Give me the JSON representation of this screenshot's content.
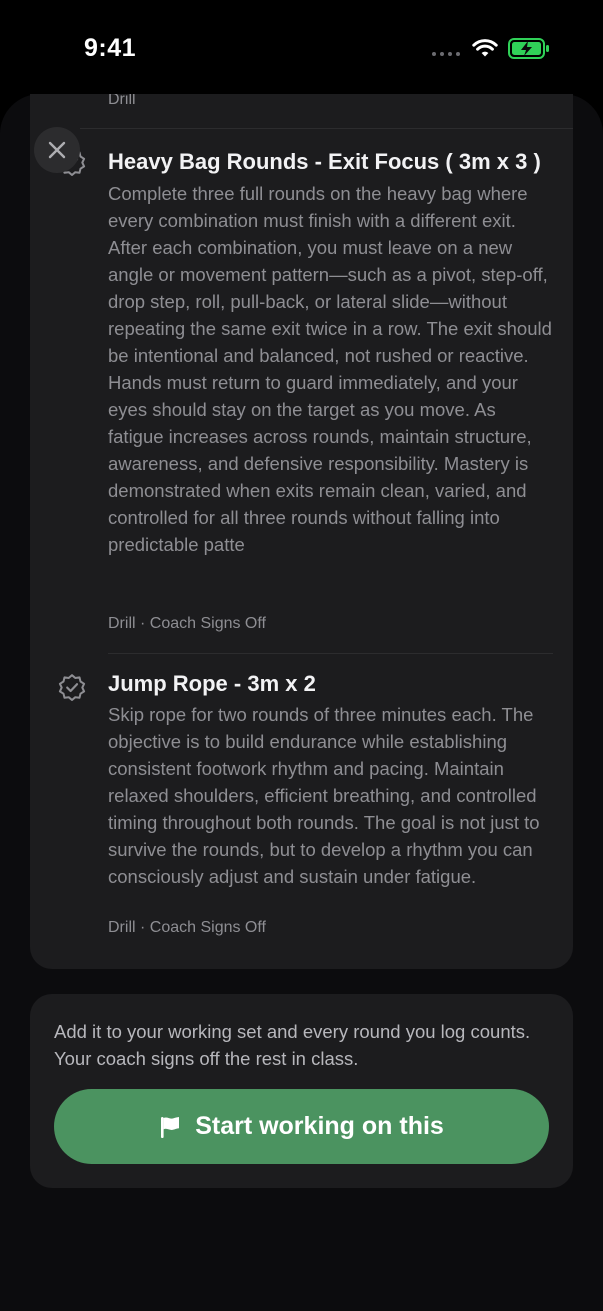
{
  "status_bar": {
    "time": "9:41",
    "icons": [
      "signal-dots-icon",
      "wifi-icon",
      "battery-charging-icon"
    ],
    "battery_color": "#30d158"
  },
  "sheet": {
    "close_icon": "close-icon",
    "previous_item": {
      "meta": "Drill"
    },
    "items": [
      {
        "icon": "check-badge-icon",
        "title": "Heavy Bag Rounds - Exit Focus ( 3m x 3 )",
        "description": "Complete three full rounds on the heavy bag where every combination must finish with a different exit. After each combination, you must leave on a new angle or movement pattern—such as a pivot, step-off, drop step, roll, pull-back, or lateral slide—without repeating the same exit twice in a row. The exit should be intentional and balanced, not rushed or reactive. Hands must return to guard immediately, and your eyes should stay on the target as you move. As fatigue increases across rounds, maintain structure, awareness, and defensive responsibility. Mastery is demonstrated when exits remain clean, varied, and controlled for all three rounds without falling into predictable patte",
        "meta": "Drill · Coach Signs Off"
      },
      {
        "icon": "check-badge-icon",
        "title": "Jump Rope - 3m x 2",
        "description": "Skip rope for two rounds of three minutes each. The objective is to build endurance while establishing consistent footwork rhythm and pacing. Maintain relaxed shoulders, efficient breathing, and controlled timing throughout both rounds. The goal is not just to survive the rounds, but to develop a rhythm you can consciously adjust and sustain under fatigue.",
        "meta": "Drill · Coach Signs Off"
      }
    ]
  },
  "footer": {
    "text": "Add it to your working set and every round you log counts. Your coach signs off the rest in class.",
    "button_label": "Start working on this",
    "button_icon": "flag-icon",
    "accent_color": "#4b9360"
  }
}
